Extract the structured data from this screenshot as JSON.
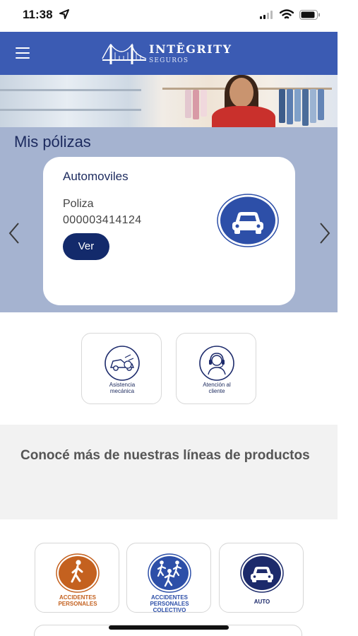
{
  "status_bar": {
    "time": "11:38"
  },
  "header": {
    "brand_name": "INTĒGRITY",
    "brand_sub": "SEGUROS"
  },
  "policies": {
    "title": "Mis pólizas",
    "card": {
      "type": "Automoviles",
      "label": "Poliza",
      "number": "000003414124",
      "button": "Ver",
      "icon": "car-icon"
    }
  },
  "quick_actions": [
    {
      "label_line1": "Asistencia",
      "label_line2": "mecánica",
      "icon": "tow-truck-icon"
    },
    {
      "label_line1": "Atención al",
      "label_line2": "cliente",
      "icon": "headset-agent-icon"
    }
  ],
  "products": {
    "title": "Conocé más de nuestras líneas de productos",
    "items": [
      {
        "line1": "ACCIDENTES",
        "line2": "PERSONALES",
        "line3": "",
        "color": "#c4611f",
        "icon": "walking-person-icon"
      },
      {
        "line1": "ACCIDENTES",
        "line2": "PERSONALES",
        "line3": "COLECTIVO",
        "color": "#2d4fa8",
        "icon": "group-people-icon"
      },
      {
        "line1": "AUTO",
        "line2": "",
        "line3": "",
        "color": "#1c2a6b",
        "icon": "car-icon"
      }
    ]
  },
  "colors": {
    "primary": "#3b5bb3",
    "navy": "#132a6b",
    "section_bg": "#a5b3d0",
    "accent_orange": "#c4611f"
  }
}
